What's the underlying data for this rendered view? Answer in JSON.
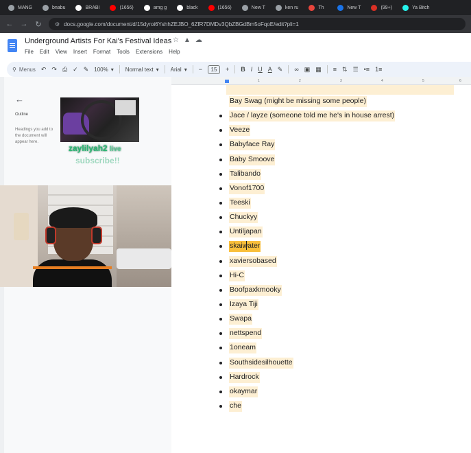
{
  "browser": {
    "tabs": [
      {
        "label": "MANG",
        "color": "#9aa0a6"
      },
      {
        "label": "bnabu",
        "color": "#9aa0a6"
      },
      {
        "label": "BRABI",
        "color": "#ffffff"
      },
      {
        "label": "(1656)",
        "color": "#ff0000"
      },
      {
        "label": "amg g",
        "color": "#ffffff"
      },
      {
        "label": "black",
        "color": "#ffffff"
      },
      {
        "label": "(1656)",
        "color": "#ff0000"
      },
      {
        "label": "New T",
        "color": "#9aa0a6"
      },
      {
        "label": "ken ru",
        "color": "#9aa0a6"
      },
      {
        "label": "Th",
        "color": "#e8453c"
      },
      {
        "label": "New T",
        "color": "#1a73e8"
      },
      {
        "label": "(99+)",
        "color": "#d93025"
      },
      {
        "label": "Ya Bitch",
        "color": "#25f4ee"
      }
    ],
    "url": "docs.google.com/document/d/15dyroi6YshhZEJBO_6ZfR7DMDv3QbZBGdBm5oFqoE/edit?pli=1"
  },
  "docs": {
    "title": "Underground Artists For Kai's Festival Ideas",
    "menu": [
      "File",
      "Edit",
      "View",
      "Insert",
      "Format",
      "Tools",
      "Extensions",
      "Help"
    ],
    "toolbar": {
      "menus_label": "Menus",
      "zoom": "100%",
      "style": "Normal text",
      "font": "Arial",
      "font_size": "15"
    }
  },
  "sidebar": {
    "title": "Outline",
    "hint": "Headings you add to the document will appear here."
  },
  "overlay": {
    "name": "zaylilyah2",
    "name_suffix": "live",
    "subscribe": "subscribe!!"
  },
  "ruler": {
    "ticks": [
      "1",
      "2",
      "3",
      "4",
      "5",
      "6"
    ]
  },
  "document": {
    "items": [
      {
        "text": "Bay Swag (might be missing some people)",
        "bullet": false
      },
      {
        "text": "Jace / layze (someone told me he's in house arrest)",
        "bullet": true
      },
      {
        "text": "Veeze",
        "bullet": true
      },
      {
        "text": "Babyface Ray",
        "bullet": true
      },
      {
        "text": "Baby Smoove",
        "bullet": true
      },
      {
        "text": "Talibando",
        "bullet": true
      },
      {
        "text": "Vonof1700",
        "bullet": true
      },
      {
        "text": "Teeski",
        "bullet": true
      },
      {
        "text": "Chuckyy",
        "bullet": true
      },
      {
        "text": "Untiljapan",
        "bullet": true
      },
      {
        "text": "skaiwater",
        "bullet": true,
        "selected": true
      },
      {
        "text": "xaviersobased",
        "bullet": true
      },
      {
        "text": "Hi-C",
        "bullet": true
      },
      {
        "text": "Boofpaxkmooky",
        "bullet": true
      },
      {
        "text": "Izaya Tiji",
        "bullet": true
      },
      {
        "text": "Swapa",
        "bullet": true
      },
      {
        "text": "nettspend",
        "bullet": true
      },
      {
        "text": "1oneam",
        "bullet": true
      },
      {
        "text": "Southsidesilhouette",
        "bullet": true
      },
      {
        "text": "Hardrock",
        "bullet": true
      },
      {
        "text": "okaymar",
        "bullet": true
      },
      {
        "text": "che",
        "bullet": true
      }
    ]
  }
}
